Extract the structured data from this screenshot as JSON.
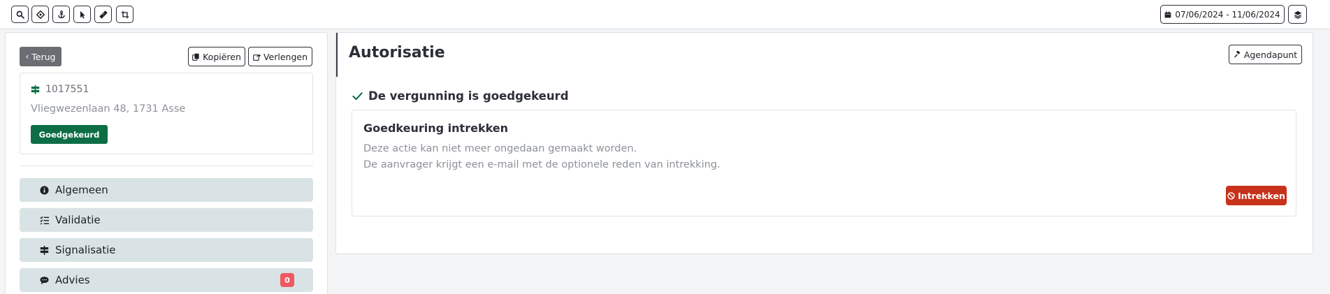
{
  "toolbar": {
    "tools": [
      "search-icon",
      "locate-icon",
      "anchor-icon",
      "pointer-icon",
      "ruler-icon",
      "crop-icon"
    ],
    "date_range": "07/06/2024 - 11/06/2024",
    "date_icon": "calendar-icon",
    "layers_icon": "layers-icon"
  },
  "left": {
    "back_label": "Terug",
    "copy_label": "Kopiëren",
    "extend_label": "Verlengen",
    "permit_number": "1017551",
    "address": "Vliegwezenlaan 48, 1731 Asse",
    "status_badge": "Goedgekeurd",
    "nav": [
      {
        "label": "Algemeen",
        "icon": "info-icon"
      },
      {
        "label": "Validatie",
        "icon": "checklist-icon"
      },
      {
        "label": "Signalisatie",
        "icon": "signpost-icon"
      },
      {
        "label": "Advies",
        "icon": "comment-icon",
        "count": "0"
      }
    ]
  },
  "main": {
    "title": "Autorisatie",
    "agenda_label": "Agendapunt",
    "approved_text": "De vergunning is goedgekeurd",
    "revoke_title": "Goedkeuring intrekken",
    "revoke_line1": "Deze actie kan niet meer ongedaan gemaakt worden.",
    "revoke_line2": "De aanvrager krijgt een e-mail met de optionele reden van intrekking.",
    "revoke_button": "Intrekken"
  },
  "colors": {
    "success": "#0d6e45",
    "danger": "#c8321a",
    "nav_bg": "#d9e3e5",
    "badge_red": "#ef5a62"
  }
}
